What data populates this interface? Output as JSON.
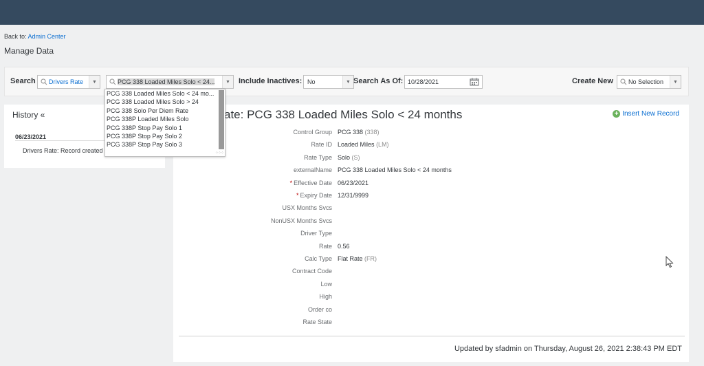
{
  "breadcrumb": {
    "prefix": "Back to:",
    "link": "Admin Center"
  },
  "page_title": "Manage Data",
  "search": {
    "label": "Search",
    "type_value": "Drivers Rate",
    "record_value": "PCG 338 Loaded Miles Solo < 24...",
    "include_inactives_label": "Include Inactives:",
    "include_inactives_value": "No",
    "search_as_of_label": "Search As Of:",
    "search_as_of_value": "10/28/2021",
    "create_new_label": "Create New",
    "create_new_value": "No Selection"
  },
  "dropdown_items": [
    "PCG 338 Loaded Miles Solo < 24 mo...",
    "PCG 338 Loaded Miles Solo > 24",
    "PCG 338 Solo Per Diem Rate",
    "PCG 338P Loaded Miles Solo",
    "PCG 338P Stop Pay Solo 1",
    "PCG 338P Stop Pay Solo 2",
    "PCG 338P Stop Pay Solo 3"
  ],
  "history": {
    "title": "History «",
    "date": "06/23/2021",
    "entry": "Drivers Rate: Record created"
  },
  "record": {
    "title": "ate: PCG 338 Loaded Miles Solo < 24 months",
    "insert_label": "Insert New Record",
    "fields": [
      {
        "key": "Control Group",
        "value": "PCG 338",
        "code": "(338)",
        "required": ""
      },
      {
        "key": "Rate ID",
        "value": "Loaded Miles",
        "code": "(LM)",
        "required": ""
      },
      {
        "key": "Rate Type",
        "value": "Solo",
        "code": "(S)",
        "required": ""
      },
      {
        "key": "externalName",
        "value": "PCG 338 Loaded Miles Solo < 24 months",
        "code": "",
        "required": ""
      },
      {
        "key": "Effective Date",
        "value": "06/23/2021",
        "code": "",
        "required": "*"
      },
      {
        "key": "Expiry Date",
        "value": "12/31/9999",
        "code": "",
        "required": "*"
      },
      {
        "key": "USX Months Svcs",
        "value": "",
        "code": "",
        "required": ""
      },
      {
        "key": "NonUSX Months Svcs",
        "value": "",
        "code": "",
        "required": ""
      },
      {
        "key": "Driver Type",
        "value": "",
        "code": "",
        "required": ""
      },
      {
        "key": "Rate",
        "value": "0.56",
        "code": "",
        "required": ""
      },
      {
        "key": "Calc Type",
        "value": "Flat Rate",
        "code": "(FR)",
        "required": ""
      },
      {
        "key": "Contract Code",
        "value": "",
        "code": "",
        "required": ""
      },
      {
        "key": "Low",
        "value": "",
        "code": "",
        "required": ""
      },
      {
        "key": "High",
        "value": "",
        "code": "",
        "required": ""
      },
      {
        "key": "Order co",
        "value": "",
        "code": "",
        "required": ""
      },
      {
        "key": "Rate State",
        "value": "",
        "code": "",
        "required": ""
      }
    ],
    "updated": "Updated by sfadmin on Thursday, August 26, 2021 2:38:43 PM EDT"
  }
}
